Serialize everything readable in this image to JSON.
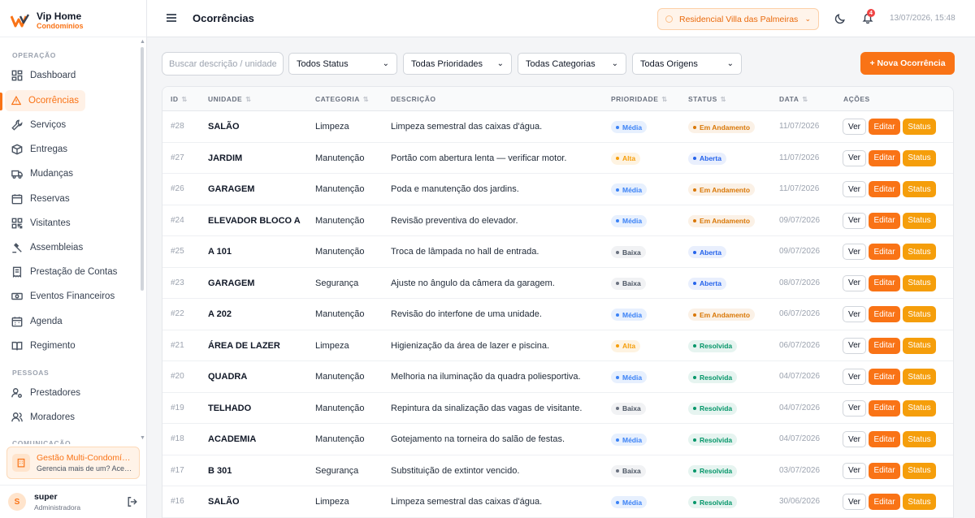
{
  "brand": {
    "name": "Vip Home",
    "subtitle": "Condomínios"
  },
  "sidebar": {
    "sections": [
      "OPERAÇÃO",
      "PESSOAS",
      "COMUNICAÇÃO"
    ],
    "items": [
      {
        "label": "Dashboard",
        "icon": "dashboard-icon",
        "active": false
      },
      {
        "label": "Ocorrências",
        "icon": "warning-icon",
        "active": true
      },
      {
        "label": "Serviços",
        "icon": "wrench-icon",
        "active": false
      },
      {
        "label": "Entregas",
        "icon": "package-icon",
        "active": false
      },
      {
        "label": "Mudanças",
        "icon": "truck-icon",
        "active": false
      },
      {
        "label": "Reservas",
        "icon": "calendar-icon",
        "active": false
      },
      {
        "label": "Visitantes",
        "icon": "qrcode-icon",
        "active": false
      },
      {
        "label": "Assembleias",
        "icon": "gavel-icon",
        "active": false
      },
      {
        "label": "Prestação de Contas",
        "icon": "receipt-icon",
        "active": false
      },
      {
        "label": "Eventos Financeiros",
        "icon": "money-icon",
        "active": false
      },
      {
        "label": "Agenda",
        "icon": "calendar-days-icon",
        "active": false
      },
      {
        "label": "Regimento",
        "icon": "book-icon",
        "active": false
      },
      {
        "label": "Prestadores",
        "icon": "user-gear-icon",
        "active": false
      },
      {
        "label": "Moradores",
        "icon": "users-icon",
        "active": false
      }
    ],
    "multi_card": {
      "title": "Gestão Multi-Condomínios",
      "desc": "Gerencia mais de um? Acesse aqui"
    },
    "user": {
      "initial": "S",
      "name": "super",
      "role": "Administradora"
    }
  },
  "header": {
    "title": "Ocorrências",
    "condo": "Residencial Villa das Palmeiras",
    "notifications": "4",
    "datetime": "13/07/2026, 15:48"
  },
  "toolbar": {
    "search_placeholder": "Buscar descrição / unidade...",
    "filters": [
      "Todos Status",
      "Todas Prioridades",
      "Todas Categorias",
      "Todas Origens"
    ],
    "new_button": "+ Nova Ocorrência"
  },
  "table": {
    "columns": [
      "ID",
      "UNIDADE",
      "CATEGORIA",
      "DESCRIÇÃO",
      "PRIORIDADE",
      "STATUS",
      "DATA",
      "AÇÕES"
    ],
    "actions": {
      "view": "Ver",
      "edit": "Editar",
      "status": "Status"
    },
    "priority_colors": {
      "Média": "#3b82f6",
      "Alta": "#f59e0b",
      "Baixa": "#6b7280"
    },
    "status_colors": {
      "Em Andamento": "#d97706",
      "Aberta": "#2563eb",
      "Resolvida": "#059669"
    },
    "rows": [
      {
        "id": "#28",
        "unit": "SALÃO",
        "category": "Limpeza",
        "description": "Limpeza semestral das caixas d'água.",
        "priority": "Média",
        "status": "Em Andamento",
        "date": "11/07/2026"
      },
      {
        "id": "#27",
        "unit": "JARDIM",
        "category": "Manutenção",
        "description": "Portão com abertura lenta — verificar motor.",
        "priority": "Alta",
        "status": "Aberta",
        "date": "11/07/2026"
      },
      {
        "id": "#26",
        "unit": "GARAGEM",
        "category": "Manutenção",
        "description": "Poda e manutenção dos jardins.",
        "priority": "Média",
        "status": "Em Andamento",
        "date": "11/07/2026"
      },
      {
        "id": "#24",
        "unit": "ELEVADOR BLOCO A",
        "category": "Manutenção",
        "description": "Revisão preventiva do elevador.",
        "priority": "Média",
        "status": "Em Andamento",
        "date": "09/07/2026"
      },
      {
        "id": "#25",
        "unit": "A 101",
        "category": "Manutenção",
        "description": "Troca de lâmpada no hall de entrada.",
        "priority": "Baixa",
        "status": "Aberta",
        "date": "09/07/2026"
      },
      {
        "id": "#23",
        "unit": "GARAGEM",
        "category": "Segurança",
        "description": "Ajuste no ângulo da câmera da garagem.",
        "priority": "Baixa",
        "status": "Aberta",
        "date": "08/07/2026"
      },
      {
        "id": "#22",
        "unit": "A 202",
        "category": "Manutenção",
        "description": "Revisão do interfone de uma unidade.",
        "priority": "Média",
        "status": "Em Andamento",
        "date": "06/07/2026"
      },
      {
        "id": "#21",
        "unit": "ÁREA DE LAZER",
        "category": "Limpeza",
        "description": "Higienização da área de lazer e piscina.",
        "priority": "Alta",
        "status": "Resolvida",
        "date": "06/07/2026"
      },
      {
        "id": "#20",
        "unit": "QUADRA",
        "category": "Manutenção",
        "description": "Melhoria na iluminação da quadra poliesportiva.",
        "priority": "Média",
        "status": "Resolvida",
        "date": "04/07/2026"
      },
      {
        "id": "#19",
        "unit": "TELHADO",
        "category": "Manutenção",
        "description": "Repintura da sinalização das vagas de visitante.",
        "priority": "Baixa",
        "status": "Resolvida",
        "date": "04/07/2026"
      },
      {
        "id": "#18",
        "unit": "ACADEMIA",
        "category": "Manutenção",
        "description": "Gotejamento na torneira do salão de festas.",
        "priority": "Média",
        "status": "Resolvida",
        "date": "04/07/2026"
      },
      {
        "id": "#17",
        "unit": "B 301",
        "category": "Segurança",
        "description": "Substituição de extintor vencido.",
        "priority": "Baixa",
        "status": "Resolvida",
        "date": "03/07/2026"
      },
      {
        "id": "#16",
        "unit": "SALÃO",
        "category": "Limpeza",
        "description": "Limpeza semestral das caixas d'água.",
        "priority": "Média",
        "status": "Resolvida",
        "date": "30/06/2026"
      }
    ]
  }
}
